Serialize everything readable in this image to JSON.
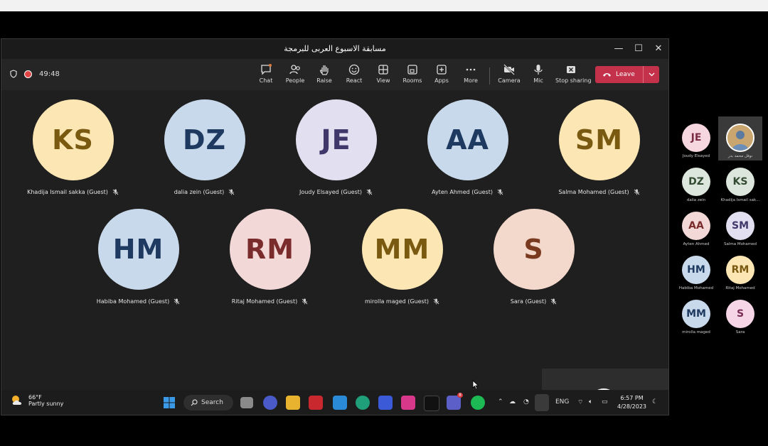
{
  "window": {
    "title": "مسابقة الاسبوع العربى للبرمجة",
    "minimize": "—",
    "maximize": "☐",
    "close": "✕"
  },
  "toolbar": {
    "timer": "49:48",
    "buttons": [
      {
        "label": "Chat",
        "icon": "chat-icon"
      },
      {
        "label": "People",
        "icon": "people-icon"
      },
      {
        "label": "Raise",
        "icon": "raise-hand-icon"
      },
      {
        "label": "React",
        "icon": "react-icon"
      },
      {
        "label": "View",
        "icon": "view-icon"
      },
      {
        "label": "Rooms",
        "icon": "rooms-icon"
      },
      {
        "label": "Apps",
        "icon": "apps-icon"
      },
      {
        "label": "More",
        "icon": "more-icon"
      },
      {
        "label": "Camera",
        "icon": "camera-off-icon"
      },
      {
        "label": "Mic",
        "icon": "mic-icon"
      },
      {
        "label": "Stop sharing",
        "icon": "stop-sharing-icon"
      }
    ],
    "leave_label": "Leave",
    "leave_color": "#c4314b"
  },
  "participants": [
    {
      "initials": "KS",
      "name": "Khadija Ismail sakka (Guest)",
      "bg": "#fbe6b4",
      "fg": "#7a5a10"
    },
    {
      "initials": "DZ",
      "name": "dalia zein (Guest)",
      "bg": "#c9d9ec",
      "fg": "#1f3a60"
    },
    {
      "initials": "JE",
      "name": "Joudy Elsayed (Guest)",
      "bg": "#e2dff0",
      "fg": "#40386a"
    },
    {
      "initials": "AA",
      "name": "Ayten Ahmed (Guest)",
      "bg": "#c9d9ec",
      "fg": "#1f3a60"
    },
    {
      "initials": "SM",
      "name": "Salma Mohamed (Guest)",
      "bg": "#fbe6b4",
      "fg": "#7a5a10"
    },
    {
      "initials": "HM",
      "name": "Habiba Mohamed (Guest)",
      "bg": "#c9d9ec",
      "fg": "#1f3a60"
    },
    {
      "initials": "RM",
      "name": "Ritaj Mohamed (Guest)",
      "bg": "#f3d8d8",
      "fg": "#7a2b2b"
    },
    {
      "initials": "MM",
      "name": "mirolla maged (Guest)",
      "bg": "#fbe6b4",
      "fg": "#7a5a10"
    },
    {
      "initials": "S",
      "name": "Sara (Guest)",
      "bg": "#f3d8cc",
      "fg": "#7a3a20"
    }
  ],
  "taskbar": {
    "temperature": "66°F",
    "weather": "Partly sunny",
    "search_label": "Search",
    "lang": "ENG",
    "time": "6:57 PM",
    "date": "4/28/2023",
    "teams_badge": "8"
  },
  "side_panel": [
    {
      "initials": "JE",
      "name": "Joudy Elsayed",
      "bg": "#f6d6df",
      "fg": "#7a2b45"
    },
    {
      "initials": "",
      "name": "نوفل محمد بدر",
      "bg": "#d8a860",
      "fg": "#ffffff",
      "photo": true
    },
    {
      "initials": "DZ",
      "name": "dalia zein",
      "bg": "#dde6dc",
      "fg": "#334a33"
    },
    {
      "initials": "KS",
      "name": "Khadija Ismail sak...",
      "bg": "#dde6dc",
      "fg": "#334a33"
    },
    {
      "initials": "AA",
      "name": "Ayten Ahmed",
      "bg": "#f3d8d8",
      "fg": "#7a2b2b"
    },
    {
      "initials": "SM",
      "name": "Salma Mohamed",
      "bg": "#e2dff0",
      "fg": "#40386a"
    },
    {
      "initials": "HM",
      "name": "Habiba Mohamed",
      "bg": "#c9d9ec",
      "fg": "#1f3a60"
    },
    {
      "initials": "RM",
      "name": "Ritaj Mohamed",
      "bg": "#fbe6b4",
      "fg": "#7a5a10"
    },
    {
      "initials": "MM",
      "name": "mirolla maged",
      "bg": "#c9d9ec",
      "fg": "#1f3a60"
    },
    {
      "initials": "S",
      "name": "Sara",
      "bg": "#f6d6e6",
      "fg": "#7a2b55"
    }
  ]
}
